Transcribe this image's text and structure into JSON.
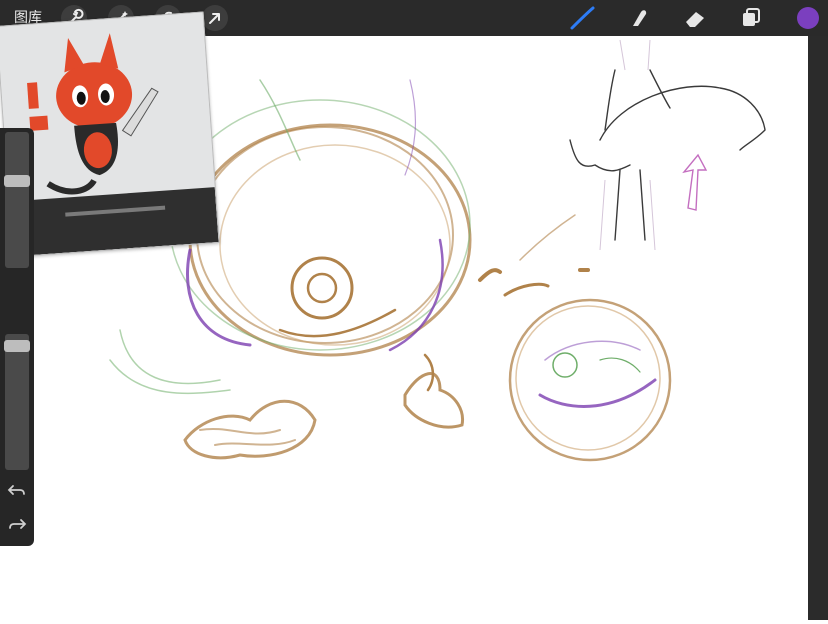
{
  "topbar": {
    "gallery_label": "图库",
    "tools": [
      {
        "name": "wrench-icon"
      },
      {
        "name": "magic-wand-icon"
      },
      {
        "name": "selection-s-icon"
      },
      {
        "name": "transform-arrow-icon"
      }
    ],
    "right_tools": [
      "brush-icon",
      "smudge-icon",
      "eraser-icon",
      "layers-icon"
    ],
    "active_color": "#7b3fbf",
    "active_tool_color": "#2d7cf6"
  },
  "sidebar": {
    "brush_size_level": 0.65,
    "opacity_level": 0.95,
    "buttons": [
      "undo-icon",
      "redo-icon"
    ]
  },
  "colors": {
    "sketch_brown": "#b0824a",
    "sketch_green": "#6fae6a",
    "sketch_purple": "#7c3fb0",
    "sketch_dark": "#3a3a3a"
  }
}
